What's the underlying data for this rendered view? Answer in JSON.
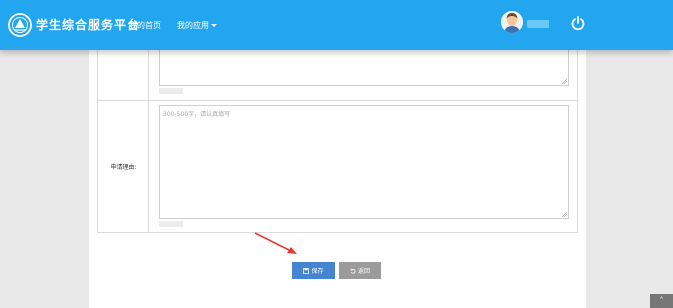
{
  "header": {
    "brand": "学生综合服务平台",
    "nav": {
      "home": "我的首页",
      "apps": "我的应用"
    },
    "colors": {
      "bar": "#23a6f0"
    },
    "icons": {
      "logo": "platform-logo-icon",
      "power": "power-icon"
    }
  },
  "form": {
    "reason_label": "申请理由:",
    "reason_placeholder": "300-500字，请认真填写"
  },
  "actions": {
    "save_label": "保存",
    "back_label": "返回",
    "colors": {
      "save": "#4484d0",
      "back": "#9b9b9b"
    }
  },
  "scroll_top": {
    "icon": "chevron-up-icon",
    "glyph": "˄"
  }
}
